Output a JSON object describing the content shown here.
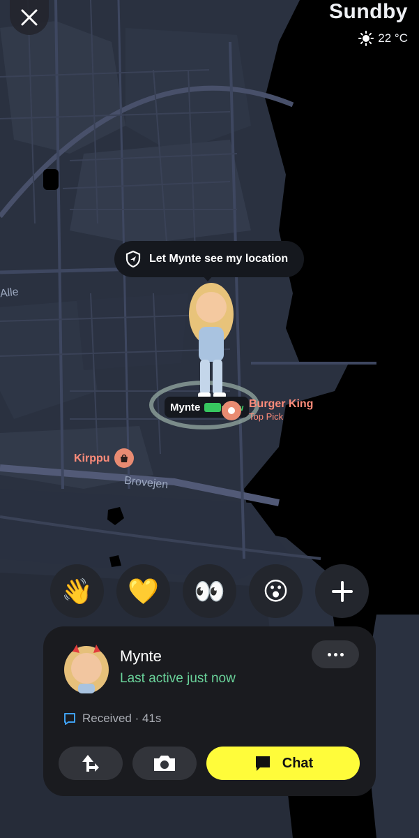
{
  "header": {
    "place_name": "Sundby",
    "temperature": "22 °C",
    "weather_icon": "sun-icon"
  },
  "map": {
    "location_prompt": "Let Mynte see my location",
    "friend_tag": {
      "name": "Mynte",
      "time": "now"
    },
    "pois": [
      {
        "name": "Burger King",
        "subtitle": "Top Pick"
      },
      {
        "name": "Kirppu"
      }
    ],
    "streets": [
      "Alle",
      "Brovejen"
    ]
  },
  "reactions": [
    "👋",
    "💛",
    "👀",
    "😮",
    "+"
  ],
  "card": {
    "friend_name": "Mynte",
    "status": "Last active just now",
    "received": "Received · 41s",
    "chat_label": "Chat"
  },
  "colors": {
    "accent_yellow": "#fffc3a",
    "status_green": "#6ad39a",
    "poi_orange": "#ff8c7a",
    "map_background": "#1f2531"
  }
}
